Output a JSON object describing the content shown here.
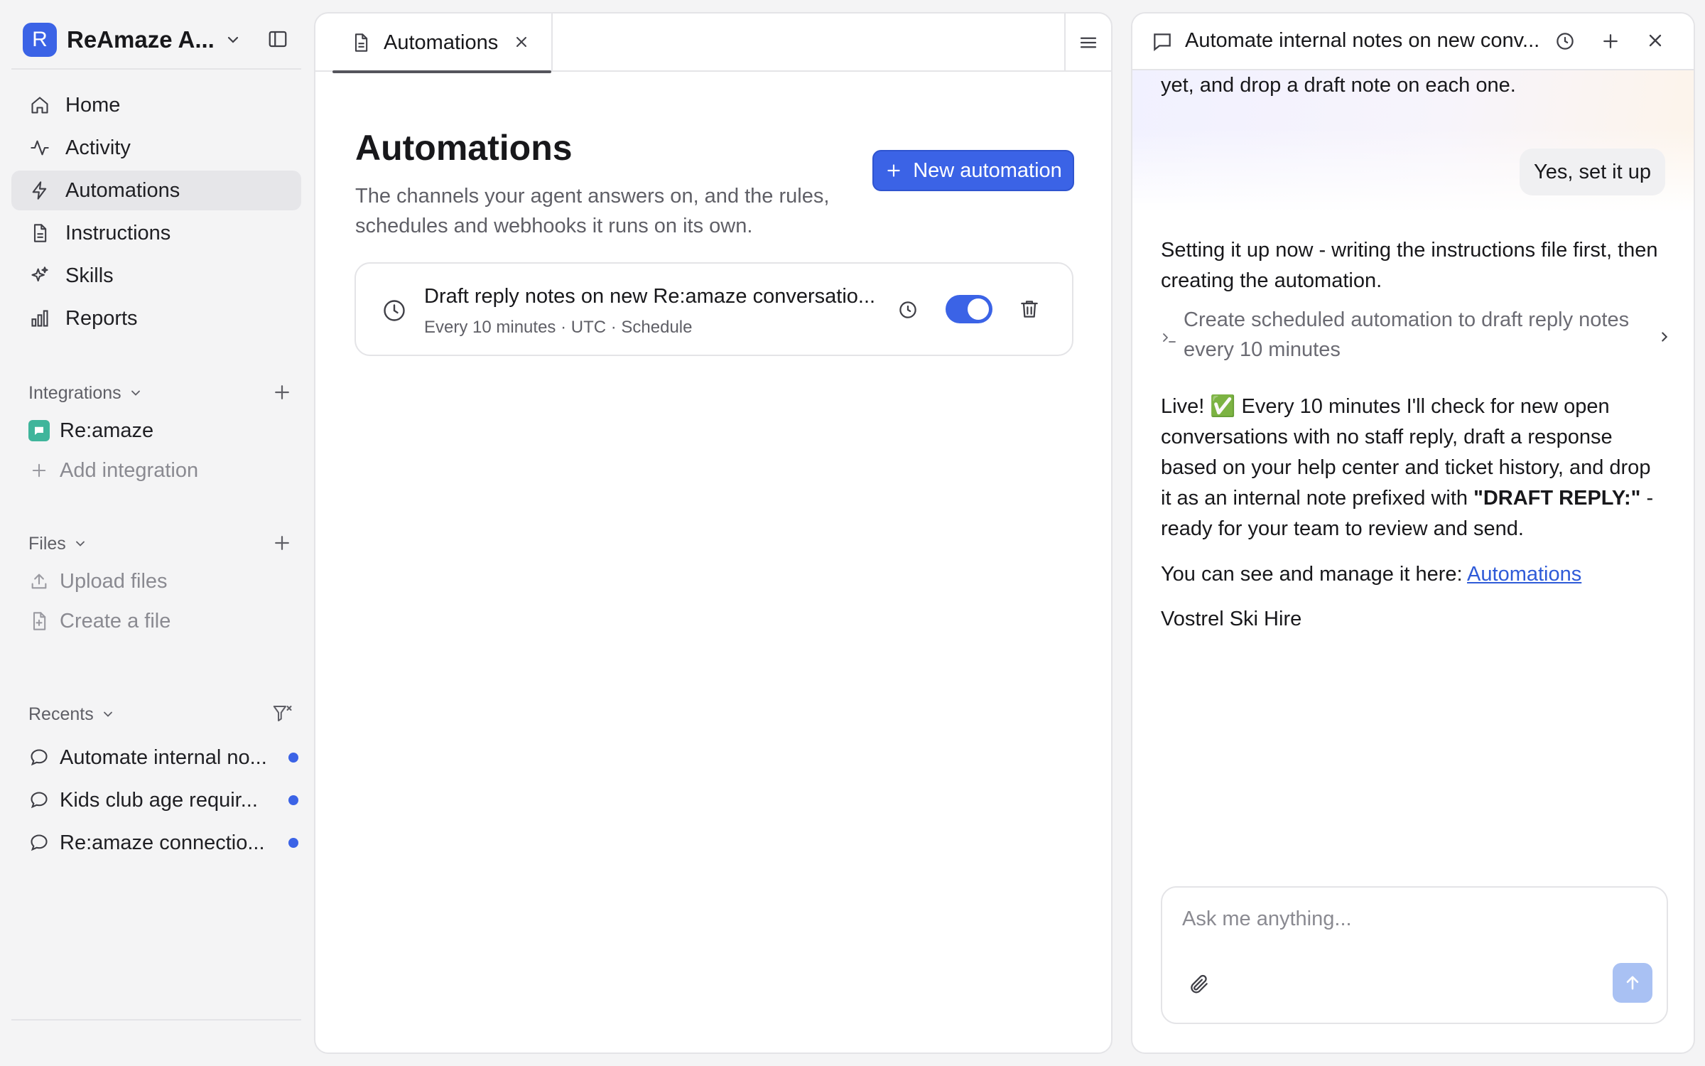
{
  "workspace": {
    "initial": "R",
    "name": "ReAmaze A..."
  },
  "nav": {
    "home": "Home",
    "activity": "Activity",
    "automations": "Automations",
    "instructions": "Instructions",
    "skills": "Skills",
    "reports": "Reports"
  },
  "integrations": {
    "header": "Integrations",
    "items": [
      "Re:amaze"
    ],
    "add": "Add integration"
  },
  "files": {
    "header": "Files",
    "upload": "Upload files",
    "create": "Create a file"
  },
  "recents": {
    "header": "Recents",
    "items": [
      "Automate internal no...",
      "Kids club age requir...",
      "Re:amaze connectio..."
    ]
  },
  "center": {
    "tab_label": "Automations",
    "title": "Automations",
    "description": "The channels your agent answers on, and the rules, schedules and webhooks it runs on its own.",
    "new_button": "New automation",
    "automations": [
      {
        "title": "Draft reply notes on new Re:amaze conversatio...",
        "meta": "Every 10 minutes · UTC · Schedule",
        "enabled": true
      }
    ]
  },
  "chat": {
    "title": "Automate internal notes on new conv...",
    "prev_text": "yet, and drop a draft note on each one.",
    "user_message": "Yes, set it up",
    "assistant_1": "Setting it up now - writing the instructions file first, then creating the automation.",
    "tool_call": "Create scheduled automation to draft reply notes every 10 minutes",
    "live_1": "Live! ✅ Every 10 minutes I'll check for new open",
    "live_2": "conversations with no staff reply, draft a response",
    "live_3": "based on your help center and ticket history, and drop",
    "live_4a": "it as an internal note prefixed with ",
    "live_4b": "\"DRAFT REPLY:\"",
    "live_4c": " -",
    "live_5": "ready for your team to review and send.",
    "manage_prefix": "You can see and manage it here: ",
    "manage_link": "Automations",
    "signature": "Vostrel Ski Hire",
    "input_placeholder": "Ask me anything..."
  },
  "colors": {
    "accent": "#3b63e6",
    "link": "#2f5bd8",
    "unread_dot": "#3b63e6",
    "integration_badge": "#3fb59b"
  },
  "icons": [
    "home-icon",
    "activity-icon",
    "bolt-icon",
    "document-icon",
    "sparkles-icon",
    "bar-chart-icon",
    "chevron-down-icon",
    "plus-icon",
    "upload-icon",
    "file-plus-icon",
    "chat-bubble-icon",
    "filter-icon",
    "close-icon",
    "menu-icon",
    "clock-icon",
    "history-icon",
    "trash-icon",
    "terminal-icon",
    "chevron-right-icon",
    "paperclip-icon",
    "arrow-up-icon",
    "sidebar-toggle-icon"
  ]
}
